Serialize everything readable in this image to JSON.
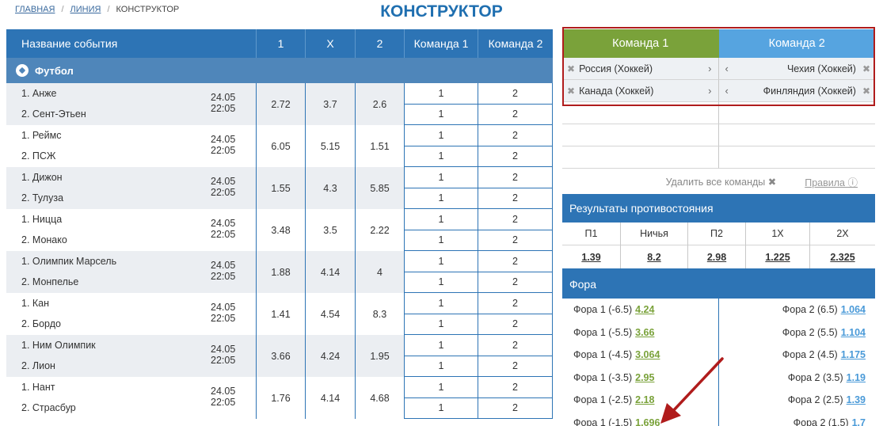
{
  "breadcrumb": {
    "home": "ГЛАВНАЯ",
    "line": "ЛИНИЯ",
    "current": "КОНСТРУКТОР"
  },
  "title": "КОНСТРУКТОР",
  "events_table": {
    "headers": {
      "name": "Название события",
      "w1": "1",
      "draw": "X",
      "w2": "2",
      "team1": "Команда 1",
      "team2": "Команда 2"
    },
    "sport": "Футбол",
    "rows": [
      {
        "team_a": "1. Анже",
        "team_b": "2. Сент-Этьен",
        "date": "24.05",
        "time": "22:05",
        "w1": "2.72",
        "x": "3.7",
        "w2": "2.6",
        "p1": "1",
        "p2": "2"
      },
      {
        "team_a": "1. Реймс",
        "team_b": "2. ПСЖ",
        "date": "24.05",
        "time": "22:05",
        "w1": "6.05",
        "x": "5.15",
        "w2": "1.51",
        "p1": "1",
        "p2": "2"
      },
      {
        "team_a": "1. Дижон",
        "team_b": "2. Тулуза",
        "date": "24.05",
        "time": "22:05",
        "w1": "1.55",
        "x": "4.3",
        "w2": "5.85",
        "p1": "1",
        "p2": "2"
      },
      {
        "team_a": "1. Ницца",
        "team_b": "2. Монако",
        "date": "24.05",
        "time": "22:05",
        "w1": "3.48",
        "x": "3.5",
        "w2": "2.22",
        "p1": "1",
        "p2": "2"
      },
      {
        "team_a": "1. Олимпик Марсель",
        "team_b": "2. Монпелье",
        "date": "24.05",
        "time": "22:05",
        "w1": "1.88",
        "x": "4.14",
        "w2": "4",
        "p1": "1",
        "p2": "2"
      },
      {
        "team_a": "1. Кан",
        "team_b": "2. Бордо",
        "date": "24.05",
        "time": "22:05",
        "w1": "1.41",
        "x": "4.54",
        "w2": "8.3",
        "p1": "1",
        "p2": "2"
      },
      {
        "team_a": "1. Ним Олимпик",
        "team_b": "2. Лион",
        "date": "24.05",
        "time": "22:05",
        "w1": "3.66",
        "x": "4.24",
        "w2": "1.95",
        "p1": "1",
        "p2": "2"
      },
      {
        "team_a": "1. Нант",
        "team_b": "2. Страсбур",
        "date": "24.05",
        "time": "22:05",
        "w1": "1.76",
        "x": "4.14",
        "w2": "4.68",
        "p1": "1",
        "p2": "2"
      }
    ]
  },
  "constructor": {
    "tab1": "Команда 1",
    "tab2": "Команда 2",
    "team1": [
      "Россия (Хоккей)",
      "Канада (Хоккей)"
    ],
    "team2": [
      "Чехия (Хоккей)",
      "Финляндия (Хоккей)"
    ],
    "delete_all": "Удалить все команды",
    "rules": "Правила"
  },
  "results": {
    "title": "Результаты противостояния",
    "labels": [
      "П1",
      "Ничья",
      "П2",
      "1Х",
      "2Х"
    ],
    "values": [
      "1.39",
      "8.2",
      "2.98",
      "1.225",
      "2.325"
    ]
  },
  "fora": {
    "title": "Фора",
    "left": [
      {
        "label": "Фора 1 (-6.5)",
        "value": "4.24"
      },
      {
        "label": "Фора 1 (-5.5)",
        "value": "3.66"
      },
      {
        "label": "Фора 1 (-4.5)",
        "value": "3.064"
      },
      {
        "label": "Фора 1 (-3.5)",
        "value": "2.95"
      },
      {
        "label": "Фора 1 (-2.5)",
        "value": "2.18"
      },
      {
        "label": "Фора 1 (-1.5)",
        "value": "1.696"
      }
    ],
    "right": [
      {
        "label": "Фора 2 (6.5)",
        "value": "1.064"
      },
      {
        "label": "Фора 2 (5.5)",
        "value": "1.104"
      },
      {
        "label": "Фора 2 (4.5)",
        "value": "1.175"
      },
      {
        "label": "Фора 2 (3.5)",
        "value": "1.19"
      },
      {
        "label": "Фора 2 (2.5)",
        "value": "1.39"
      },
      {
        "label": "Фора 2 (1.5)",
        "value": "1.7"
      }
    ]
  },
  "colors": {
    "header_blue": "#2d74b5",
    "team1_green": "#7aa23a",
    "team2_blue": "#56a4e0",
    "highlight_red": "#b01c1c",
    "title_blue": "#1f6fb0"
  }
}
